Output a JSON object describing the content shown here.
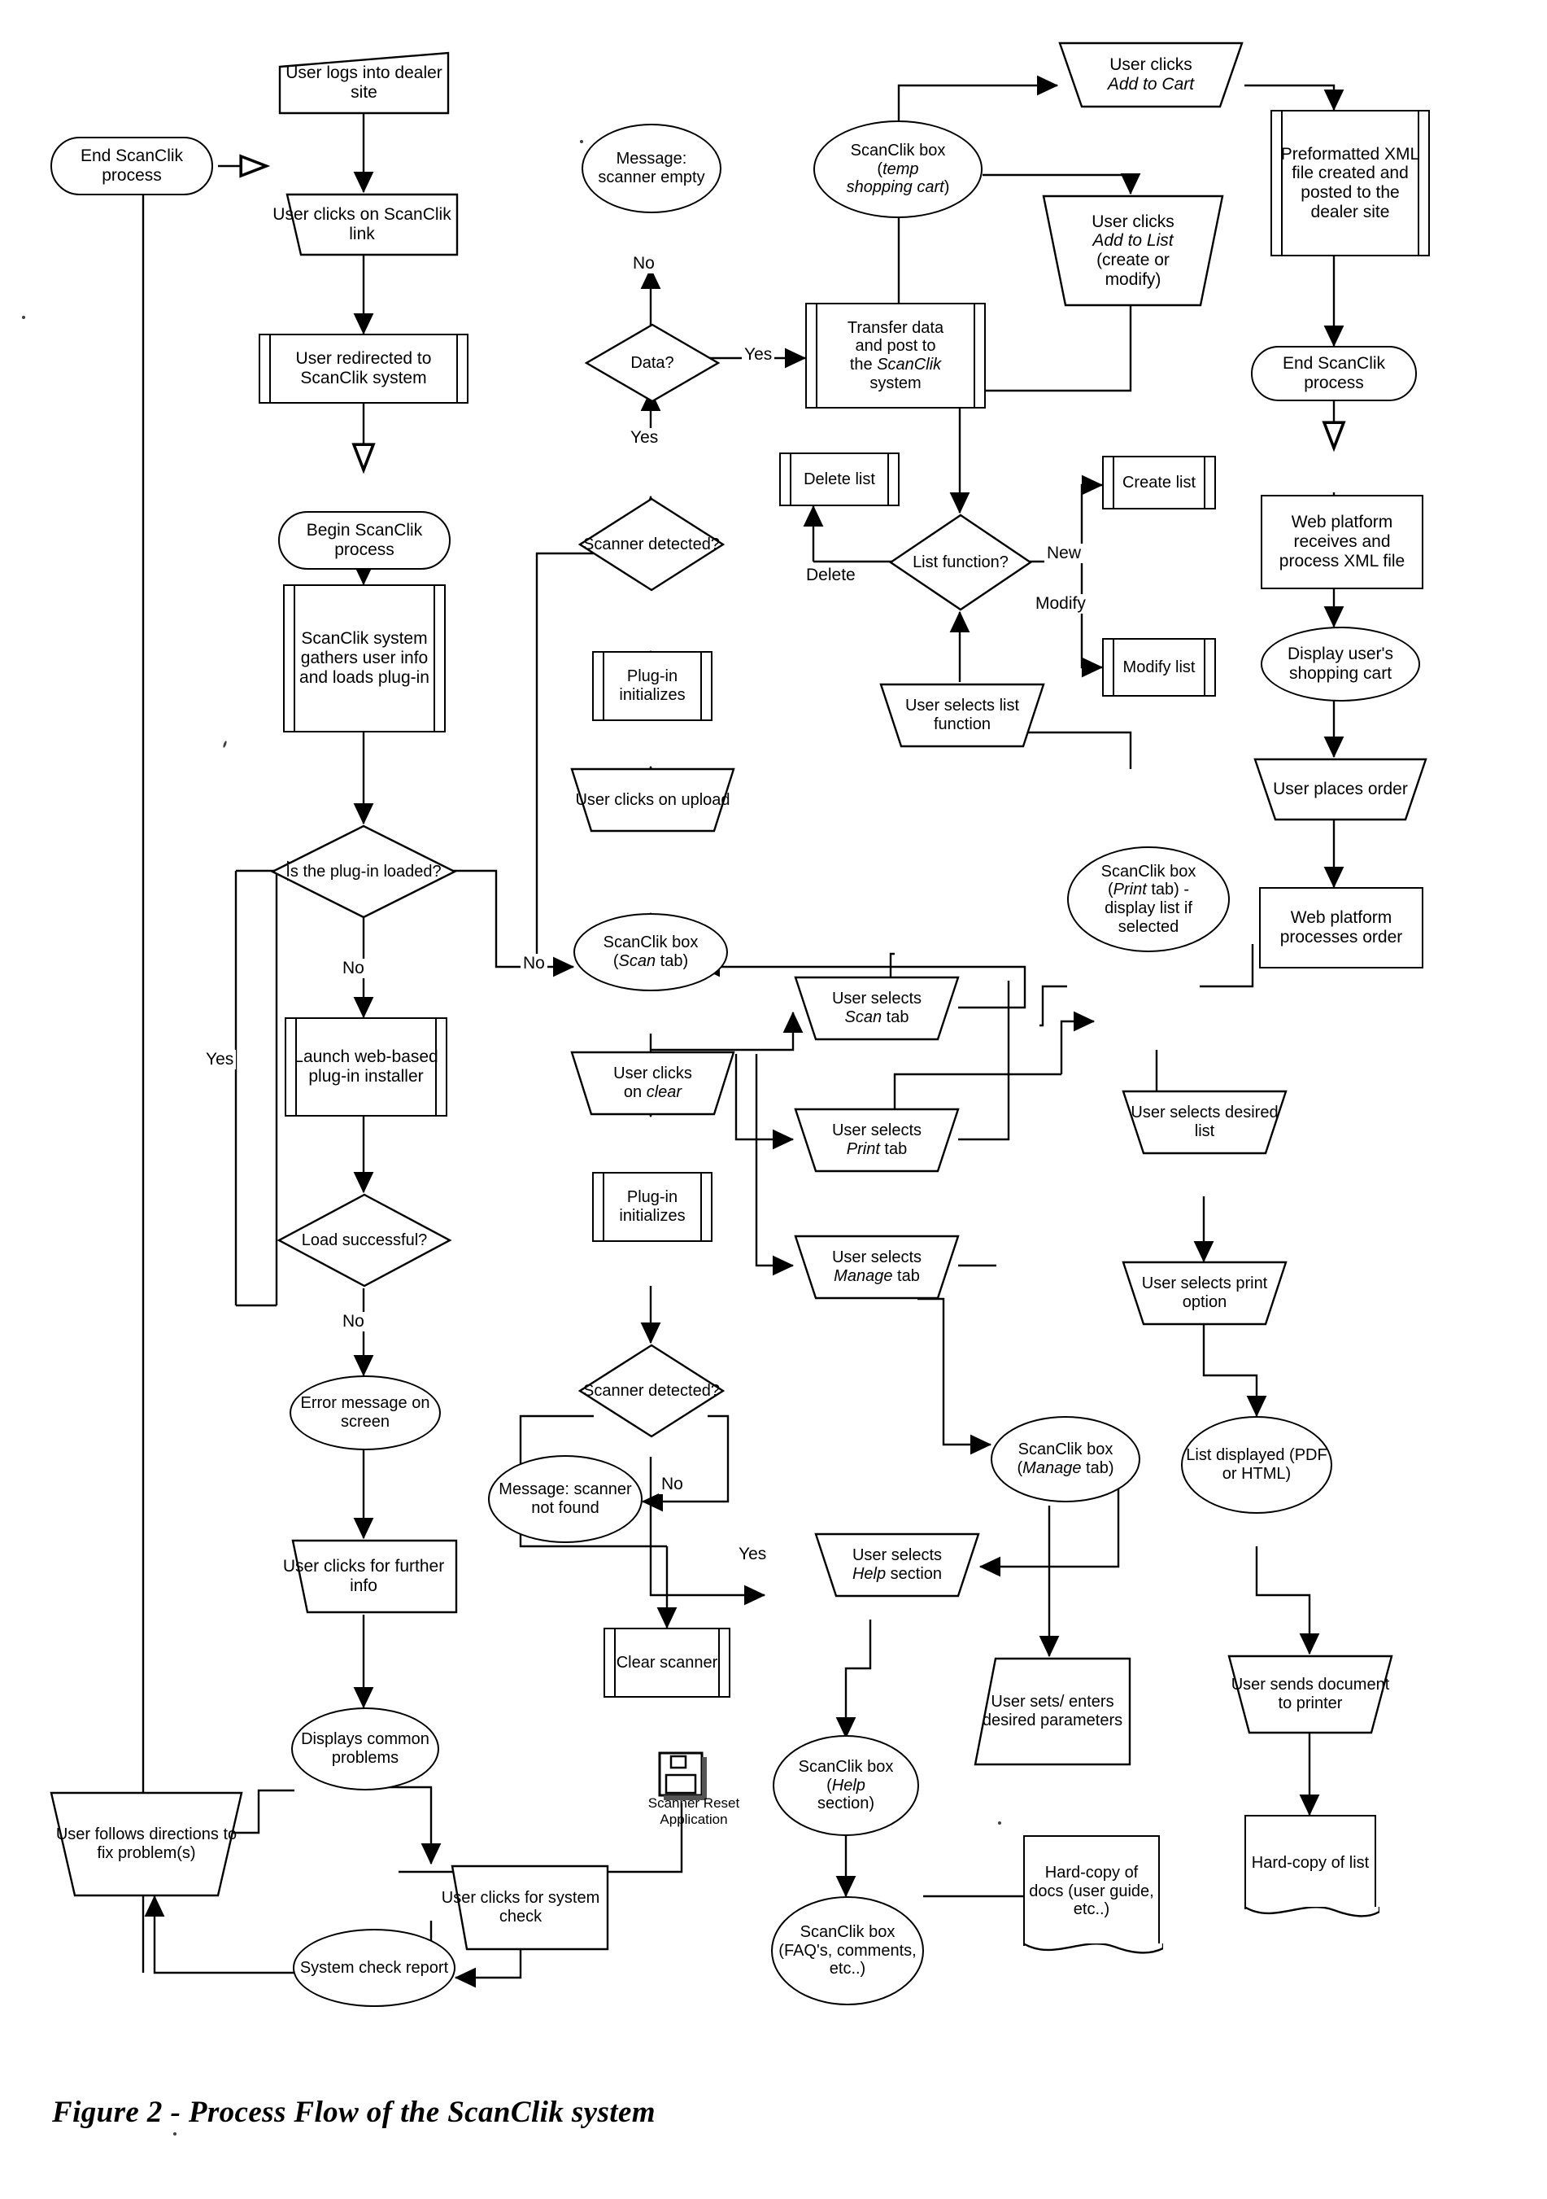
{
  "figure": {
    "caption": "Figure 2 - Process Flow of the ScanClik system"
  },
  "icon": {
    "scanner_reset_label": "Scanner Reset Application"
  },
  "nodes": {
    "user_logs_in": "User logs into dealer site",
    "user_clicks_scanclik_link": "User clicks on ScanClik link",
    "user_redirected": "User redirected to ScanClik system",
    "begin_process": "Begin ScanClik process",
    "system_gathers": "ScanClik system gathers user info and loads plug-in",
    "is_plugin_loaded": "Is the plug-in loaded?",
    "launch_installer": "Launch web-based plug-in installer",
    "load_successful": "Load successful?",
    "error_message": "Error message on screen",
    "user_clicks_further_info": "User clicks for further info",
    "displays_common_problems": "Displays common problems",
    "user_follows_directions": "User follows directions to fix problem(s)",
    "user_clicks_system_check": "User clicks for system check",
    "system_check_report": "System check report",
    "end_process_left": "End ScanClik process",
    "message_scanner_empty": "Message: scanner empty",
    "data_decision": "Data?",
    "scanner_detected_top": "Scanner detected?",
    "plugin_initializes_top": "Plug-in initializes",
    "user_clicks_upload": "User clicks on upload",
    "scanclik_box_scan_tab": "ScanClik box (Scan tab)",
    "user_clicks_clear": "User clicks on clear",
    "plugin_initializes_bottom": "Plug-in initializes",
    "scanner_detected_bottom": "Scanner detected?",
    "message_scanner_not_found": "Message: scanner not found",
    "clear_scanner": "Clear scanner",
    "transfer_data": "Transfer data and post to the ScanClik system",
    "scanclik_box_temp_cart": "ScanClik box (temp shopping cart)",
    "user_clicks_add_to_cart": "User clicks Add to Cart",
    "user_clicks_add_to_list": "User clicks Add to List (create or modify)",
    "preformatted_xml": "Preformatted XML file created and posted to the dealer site",
    "end_process_right": "End ScanClik process",
    "web_platform_receives": "Web platform receives and process XML file",
    "display_shopping_cart": "Display user's shopping cart",
    "user_places_order": "User places order",
    "web_platform_processes": "Web platform processes order",
    "delete_list": "Delete list",
    "create_list": "Create list",
    "modify_list": "Modify list",
    "list_function": "List function?",
    "user_selects_list_function": "User selects list function",
    "user_selects_scan_tab": "User selects Scan tab",
    "user_selects_print_tab": "User selects Print tab",
    "user_selects_manage_tab": "User selects Manage tab",
    "scanclik_box_print_tab": "ScanClik box (Print tab) - display list if selected",
    "user_selects_desired_list": "User selects desired list",
    "user_selects_print_option": "User selects print option",
    "list_displayed": "List displayed (PDF or HTML)",
    "user_sends_document": "User sends document to printer",
    "hard_copy_of_list": "Hard-copy of list",
    "scanclik_box_manage_tab": "ScanClik box (Manage tab)",
    "user_selects_help_section": "User selects Help section",
    "user_sets_parameters": "User sets/ enters desired parameters",
    "scanclik_box_help_section": "ScanClik box (Help section)",
    "scanclik_box_faq": "ScanClik box (FAQ's, comments, etc..)",
    "hard_copy_of_docs": "Hard-copy of docs (user guide, etc..)"
  },
  "edge_labels": {
    "plugin_no": "No",
    "plugin_yes": "Yes",
    "load_no": "No",
    "load_yes": "Yes",
    "data_no": "No",
    "data_yes_up": "Yes",
    "data_yes_right": "Yes",
    "scanner_top_no": "No",
    "scanner_bottom_no": "No",
    "scanner_bottom_yes": "Yes",
    "list_delete": "Delete",
    "list_new": "New",
    "list_modify": "Modify"
  },
  "colors": {
    "ink": "#000000",
    "paper": "#ffffff"
  }
}
